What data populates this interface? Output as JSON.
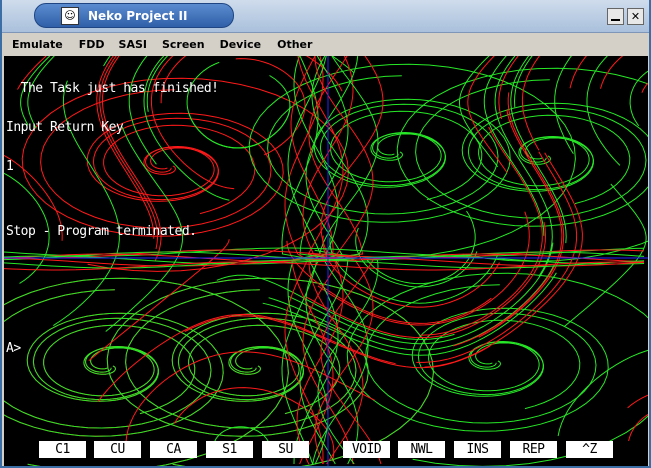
{
  "window": {
    "title": "Neko Project II",
    "app_icon_glyph": "☺",
    "minimize_glyph": "",
    "close_glyph": "✕"
  },
  "menu": [
    "Emulate",
    "FDD",
    "SASI",
    "Screen",
    "Device",
    "Other"
  ],
  "terminal": {
    "lines": [
      "  The Task just has finished!",
      "Input Return Key",
      "1",
      "",
      "Stop - Program terminated.",
      "",
      "",
      "",
      "A>"
    ]
  },
  "function_keys": [
    "C1",
    "CU",
    "CA",
    "S1",
    "SU",
    "VOID",
    "NWL",
    "INS",
    "REP",
    "^Z"
  ],
  "colors": {
    "axis": "#2323ff",
    "curve_a": "#ff1a1a",
    "curve_b": "#27e827",
    "title_pill": "#3a6ec0"
  }
}
